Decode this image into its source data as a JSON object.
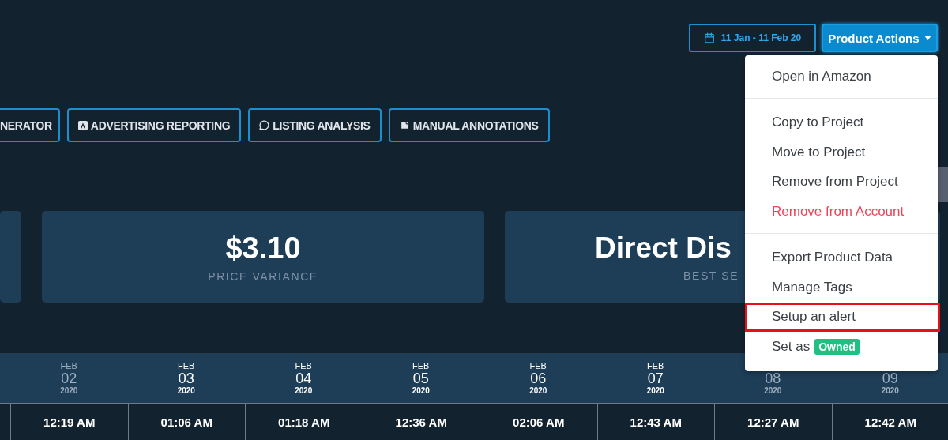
{
  "toolbar": {
    "date_range": "11 Jan - 11 Feb 20",
    "actions_button": "Product Actions"
  },
  "actions_menu": {
    "groups": [
      [
        {
          "label": "Open in Amazon",
          "kind": "normal",
          "highlighted": false
        }
      ],
      [
        {
          "label": "Copy to Project",
          "kind": "normal",
          "highlighted": false
        },
        {
          "label": "Move to Project",
          "kind": "normal",
          "highlighted": false
        },
        {
          "label": "Remove from Project",
          "kind": "normal",
          "highlighted": false
        },
        {
          "label": "Remove from Account",
          "kind": "danger",
          "highlighted": false
        }
      ],
      [
        {
          "label": "Export Product Data",
          "kind": "normal",
          "highlighted": false
        },
        {
          "label": "Manage Tags",
          "kind": "normal",
          "highlighted": false
        },
        {
          "label": "Setup an alert",
          "kind": "normal",
          "highlighted": true
        },
        {
          "label": "Set as",
          "kind": "badge",
          "badge": "Owned",
          "highlighted": false
        }
      ]
    ]
  },
  "tabs": [
    {
      "label": "NERATOR",
      "kind": "plain"
    },
    {
      "label": "ADVERTISING REPORTING",
      "kind": "ad"
    },
    {
      "label": "LISTING ANALYSIS",
      "kind": "comment"
    },
    {
      "label": "MANUAL ANNOTATIONS",
      "kind": "note"
    }
  ],
  "stats": [
    {
      "kind": "edge"
    },
    {
      "kind": "full",
      "value": "$3.10",
      "label": "PRICE VARIANCE"
    },
    {
      "kind": "covered",
      "value": "Direct Dis",
      "label": "BEST SE"
    }
  ],
  "days": [
    {
      "month": "FEB",
      "day": "02",
      "year": "2020",
      "weekend": true,
      "time": "12:19 AM"
    },
    {
      "month": "FEB",
      "day": "03",
      "year": "2020",
      "weekend": false,
      "time": "01:06 AM"
    },
    {
      "month": "FEB",
      "day": "04",
      "year": "2020",
      "weekend": false,
      "time": "01:18 AM"
    },
    {
      "month": "FEB",
      "day": "05",
      "year": "2020",
      "weekend": false,
      "time": "12:36 AM"
    },
    {
      "month": "FEB",
      "day": "06",
      "year": "2020",
      "weekend": false,
      "time": "02:06 AM"
    },
    {
      "month": "FEB",
      "day": "07",
      "year": "2020",
      "weekend": false,
      "time": "12:43 AM"
    },
    {
      "day": "08",
      "year": "2020",
      "weekend": true,
      "time": "12:27 AM"
    },
    {
      "day": "09",
      "year": "2020",
      "weekend": true,
      "time": "12:42 AM"
    }
  ]
}
